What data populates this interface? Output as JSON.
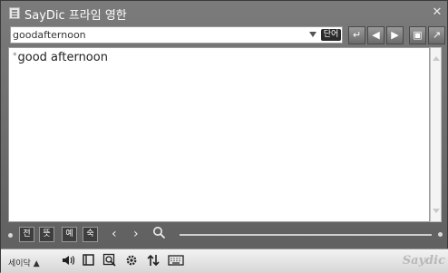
{
  "window": {
    "title": "SayDic 프라임 영한",
    "close_symbol": "✕"
  },
  "search": {
    "value": "goodafternoon",
    "placeholder": "",
    "mode_badge": "단어"
  },
  "nav": {
    "enter": "↵",
    "back": "◀",
    "forward": "▶",
    "panel": "▣",
    "resize": "↗"
  },
  "result": {
    "mark": "*",
    "headword": "good afternoon"
  },
  "toolbar": {
    "buttons": [
      "전",
      "뜻",
      "예",
      "숙"
    ],
    "prev": "‹",
    "next": "›",
    "search": "🔍"
  },
  "statusbar": {
    "label": "세이닥 ▲",
    "brand": "Saydic",
    "icons": [
      "speaker-icon",
      "book-icon",
      "search-doc-icon",
      "gear-icon",
      "sort-icon",
      "keyboard-icon"
    ]
  },
  "colors": {
    "frame": "#6f6f6f",
    "content_bg": "#ffffff",
    "badge": "#2b2b2b"
  }
}
